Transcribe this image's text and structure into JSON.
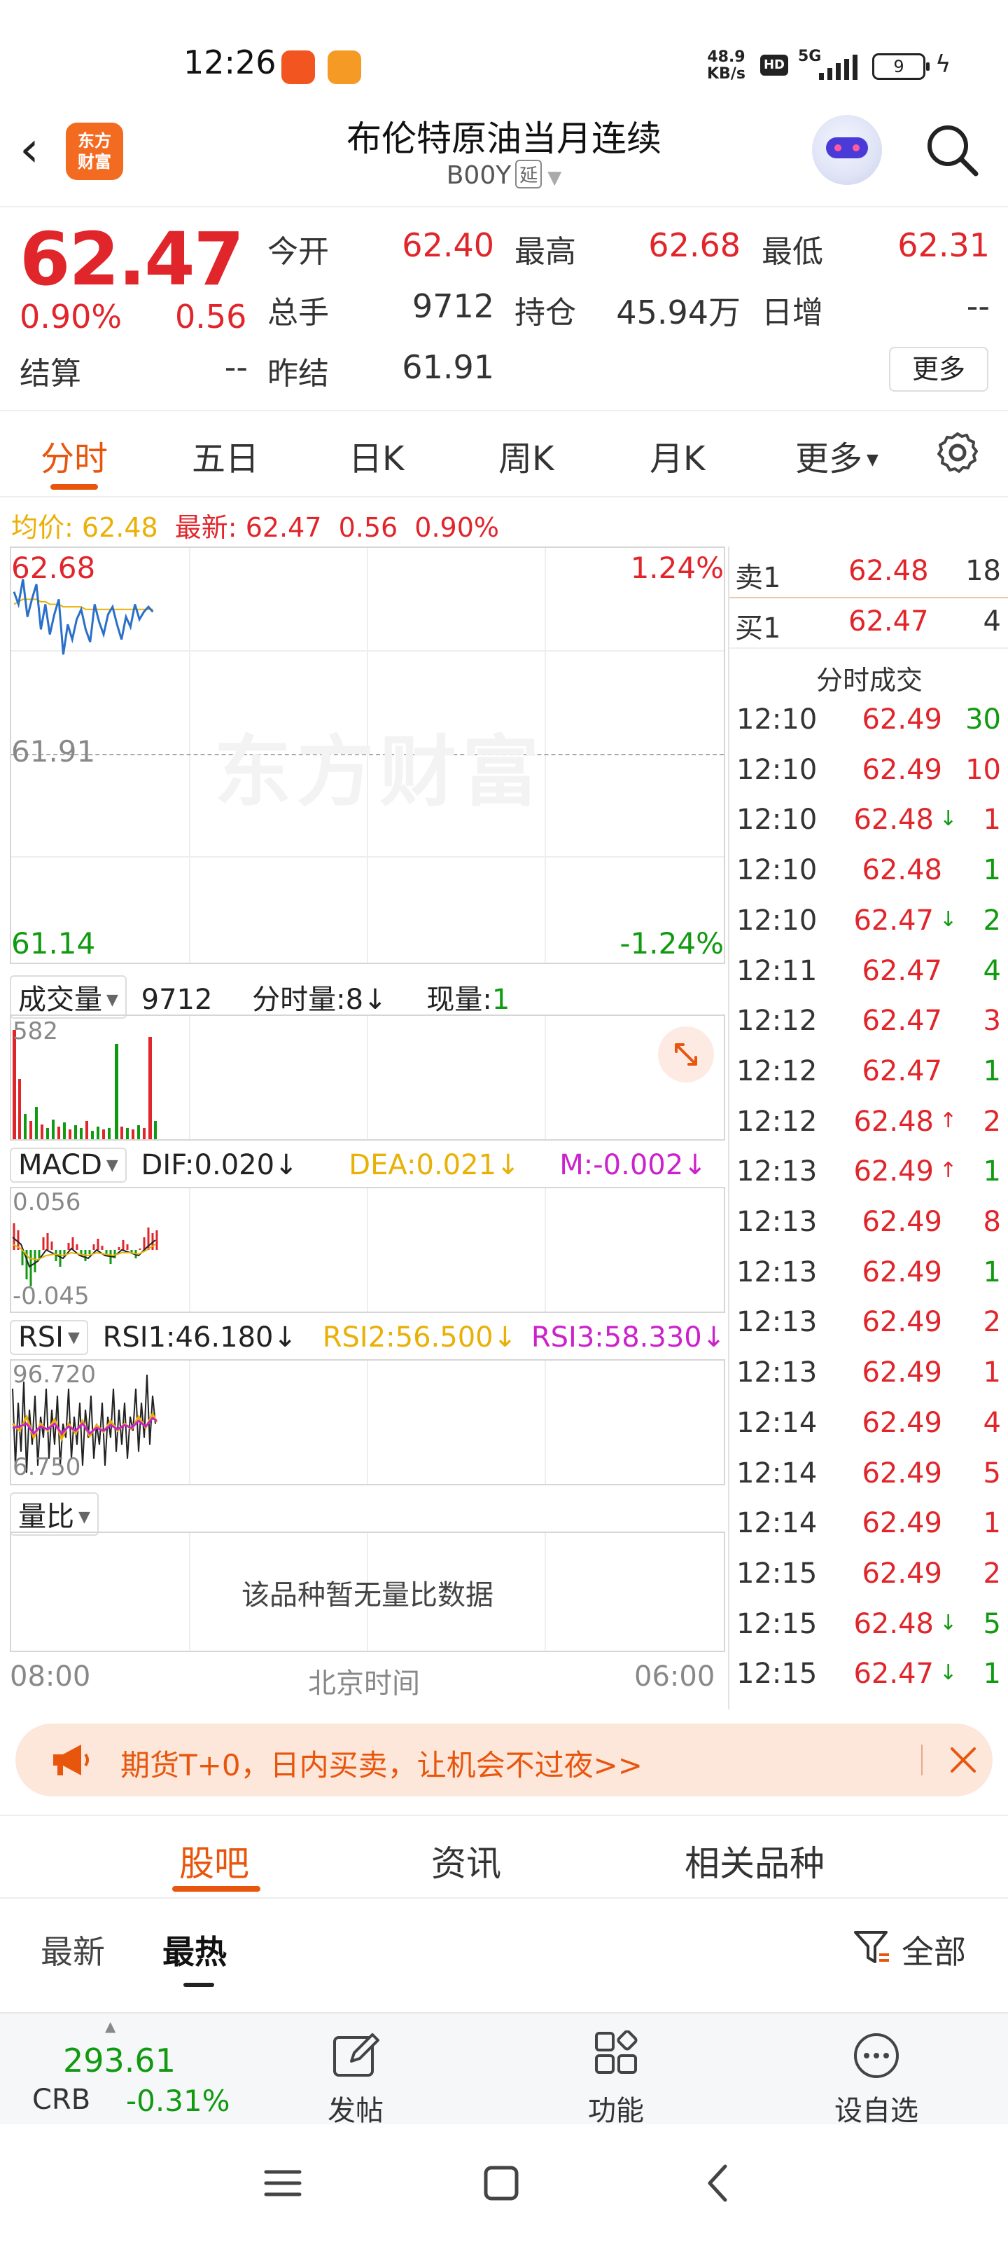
{
  "status_bar": {
    "time": "12:26",
    "net_speed": "48.9",
    "net_unit": "KB/s",
    "hd": "HD",
    "signal": "5G",
    "battery": "9"
  },
  "header": {
    "logo_text": "东方财富",
    "title": "布伦特原油当月连续",
    "code": "B00Y",
    "code_tag": "延"
  },
  "quote": {
    "price": "62.47",
    "change_pct": "0.90%",
    "change": "0.56",
    "fields": [
      {
        "label": "今开",
        "value": "62.40",
        "color": "red"
      },
      {
        "label": "最高",
        "value": "62.68",
        "color": "red"
      },
      {
        "label": "最低",
        "value": "62.31",
        "color": "red"
      },
      {
        "label": "总手",
        "value": "9712",
        "color": "dark"
      },
      {
        "label": "持仓",
        "value": "45.94万",
        "color": "dark"
      },
      {
        "label": "日增",
        "value": "--",
        "color": "dark"
      },
      {
        "label": "结算",
        "value": "--",
        "color": "dark"
      },
      {
        "label": "昨结",
        "value": "61.91",
        "color": "dark"
      }
    ],
    "more_label": "更多"
  },
  "tabs": [
    "分时",
    "五日",
    "日K",
    "周K",
    "月K",
    "更多"
  ],
  "info_line": {
    "avg_label": "均价:",
    "avg_value": "62.48",
    "latest_label": "最新:",
    "latest_value": "62.47",
    "change": "0.56",
    "change_pct": "0.90%"
  },
  "chart": {
    "high": "62.68",
    "high_pct": "1.24%",
    "prev": "61.91",
    "low": "61.14",
    "low_pct": "-1.24%",
    "watermark": "东方财富",
    "volume_label": "成交量",
    "volume_total": "9712",
    "minute_vol_label": "分时量:8↓",
    "current_vol_label": "现量:",
    "current_vol_value": "1",
    "vol_max": "582",
    "macd_label": "MACD",
    "dif": "DIF:0.020↓",
    "dea": "DEA:0.021↓",
    "m": "M:-0.002↓",
    "macd_max": "0.056",
    "macd_min": "-0.045",
    "rsi_label": "RSI",
    "rsi1": "RSI1:46.180↓",
    "rsi2": "RSI2:56.500↓",
    "rsi3": "RSI3:58.330↓",
    "rsi_max": "96.720",
    "rsi_min": "6.750",
    "ratio_label": "量比",
    "ratio_empty": "该品种暂无量比数据",
    "time_start": "08:00",
    "time_mid": "北京时间",
    "time_end": "06:00"
  },
  "chart_data": {
    "type": "line",
    "ylim": [
      61.14,
      62.68
    ],
    "reference": 61.91,
    "price": [
      62.55,
      62.5,
      62.6,
      62.45,
      62.52,
      62.58,
      62.4,
      62.5,
      62.38,
      62.46,
      62.52,
      62.3,
      62.42,
      62.36,
      62.44,
      62.48,
      62.4,
      62.35,
      62.5,
      62.43,
      62.38,
      62.46,
      62.49,
      62.42,
      62.36,
      62.45,
      62.41,
      62.5,
      62.44,
      62.47,
      62.49,
      62.47
    ],
    "avg": [
      62.5,
      62.51,
      62.52,
      62.52,
      62.52,
      62.52,
      62.51,
      62.51,
      62.5,
      62.5,
      62.5,
      62.49,
      62.49,
      62.49,
      62.49,
      62.49,
      62.48,
      62.48,
      62.48,
      62.48,
      62.48,
      62.48,
      62.48,
      62.48,
      62.48,
      62.48,
      62.48,
      62.48,
      62.48,
      62.48,
      62.48,
      62.48
    ]
  },
  "order_book": [
    {
      "label": "卖1",
      "price": "62.48",
      "vol": "18"
    },
    {
      "label": "买1",
      "price": "62.47",
      "vol": "4"
    }
  ],
  "tape_title": "分时成交",
  "trades": [
    {
      "time": "12:10",
      "price": "62.49",
      "arrow": "",
      "vol": "30",
      "vcolor": "green"
    },
    {
      "time": "12:10",
      "price": "62.49",
      "arrow": "",
      "vol": "10",
      "vcolor": "red"
    },
    {
      "time": "12:10",
      "price": "62.48",
      "arrow": "↓",
      "vol": "1",
      "vcolor": "red"
    },
    {
      "time": "12:10",
      "price": "62.48",
      "arrow": "",
      "vol": "1",
      "vcolor": "green"
    },
    {
      "time": "12:10",
      "price": "62.47",
      "arrow": "↓",
      "vol": "2",
      "vcolor": "green"
    },
    {
      "time": "12:11",
      "price": "62.47",
      "arrow": "",
      "vol": "4",
      "vcolor": "green"
    },
    {
      "time": "12:12",
      "price": "62.47",
      "arrow": "",
      "vol": "3",
      "vcolor": "red"
    },
    {
      "time": "12:12",
      "price": "62.47",
      "arrow": "",
      "vol": "1",
      "vcolor": "green"
    },
    {
      "time": "12:12",
      "price": "62.48",
      "arrow": "↑",
      "vol": "2",
      "vcolor": "red"
    },
    {
      "time": "12:13",
      "price": "62.49",
      "arrow": "↑",
      "vol": "1",
      "vcolor": "green"
    },
    {
      "time": "12:13",
      "price": "62.49",
      "arrow": "",
      "vol": "8",
      "vcolor": "red"
    },
    {
      "time": "12:13",
      "price": "62.49",
      "arrow": "",
      "vol": "1",
      "vcolor": "green"
    },
    {
      "time": "12:13",
      "price": "62.49",
      "arrow": "",
      "vol": "2",
      "vcolor": "red"
    },
    {
      "time": "12:13",
      "price": "62.49",
      "arrow": "",
      "vol": "1",
      "vcolor": "red"
    },
    {
      "time": "12:14",
      "price": "62.49",
      "arrow": "",
      "vol": "4",
      "vcolor": "red"
    },
    {
      "time": "12:14",
      "price": "62.49",
      "arrow": "",
      "vol": "5",
      "vcolor": "red"
    },
    {
      "time": "12:14",
      "price": "62.49",
      "arrow": "",
      "vol": "1",
      "vcolor": "red"
    },
    {
      "time": "12:15",
      "price": "62.49",
      "arrow": "",
      "vol": "2",
      "vcolor": "red"
    },
    {
      "time": "12:15",
      "price": "62.48",
      "arrow": "↓",
      "vol": "5",
      "vcolor": "green"
    },
    {
      "time": "12:15",
      "price": "62.47",
      "arrow": "↓",
      "vol": "1",
      "vcolor": "green"
    }
  ],
  "banner": {
    "text": "期货T+0，日内买卖，让机会不过夜>>"
  },
  "lower_tabs": [
    "股吧",
    "资讯",
    "相关品种"
  ],
  "sort": {
    "latest": "最新",
    "hottest": "最热",
    "filter": "全部"
  },
  "bottom_bar": {
    "price": "293.61",
    "symbol": "CRB",
    "change_pct": "-0.31%",
    "post": "发帖",
    "functions": "功能",
    "watchlist": "设自选"
  },
  "colors": {
    "accent": "#e8560e",
    "up": "#e0252b",
    "down": "#109a10",
    "avg_line": "#e9b006",
    "price_line": "#2a6fc9"
  }
}
